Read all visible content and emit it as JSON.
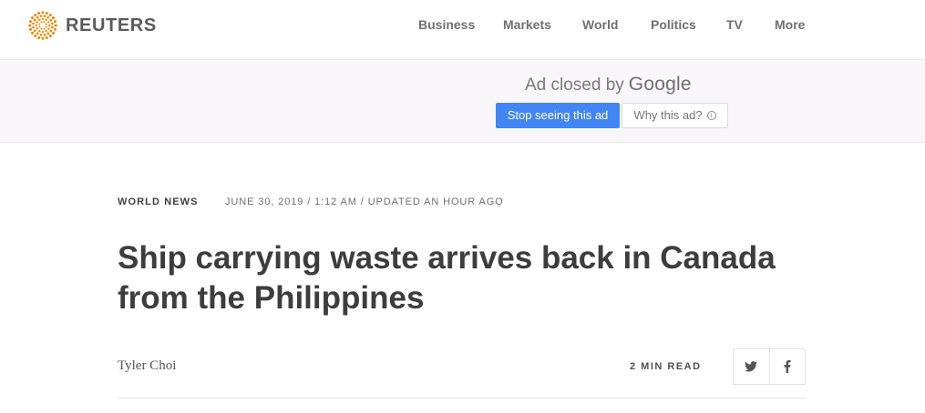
{
  "header": {
    "logo_text": "REUTERS",
    "logo_icon": "reuters-dot-sunburst-icon",
    "brand_color": "#f18700",
    "nav": [
      {
        "label": "Business"
      },
      {
        "label": "Markets"
      },
      {
        "label": "World"
      },
      {
        "label": "Politics"
      },
      {
        "label": "TV"
      },
      {
        "label": "More"
      }
    ]
  },
  "ad": {
    "closed_text": "Ad closed by",
    "provider": "Google",
    "stop_label": "Stop seeing this ad",
    "why_label": "Why this ad?",
    "info_icon": "info-circle-icon",
    "stop_button_color": "#4285f4"
  },
  "article": {
    "section": "WORLD NEWS",
    "dateline": "JUNE 30, 2019 / 1:12 AM / UPDATED AN HOUR AGO",
    "headline": "Ship carrying waste arrives back in Canada from the Philippines",
    "author": "Tyler Choi",
    "read_time": "2 MIN READ",
    "share_icons": [
      "twitter-icon",
      "facebook-icon"
    ]
  }
}
